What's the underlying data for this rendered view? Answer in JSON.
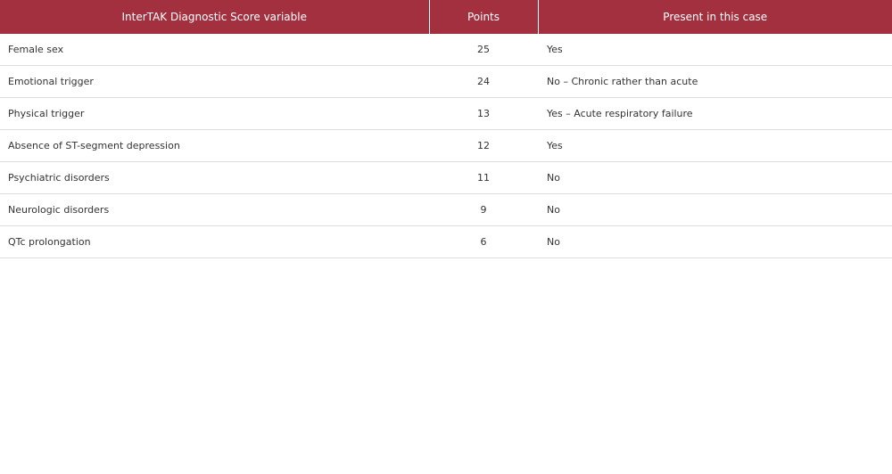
{
  "table": {
    "headers": {
      "variable": "InterTAK Diagnostic Score variable",
      "points": "Points",
      "present": "Present in this case"
    },
    "rows": [
      {
        "variable": "Female sex",
        "points": "25",
        "present": "Yes"
      },
      {
        "variable": "Emotional trigger",
        "points": "24",
        "present": "No – Chronic rather than acute"
      },
      {
        "variable": "Physical trigger",
        "points": "13",
        "present": "Yes – Acute respiratory failure"
      },
      {
        "variable": "Absence of ST-segment depression",
        "points": "12",
        "present": "Yes"
      },
      {
        "variable": "Psychiatric disorders",
        "points": "11",
        "present": "No"
      },
      {
        "variable": "Neurologic disorders",
        "points": "9",
        "present": "No"
      },
      {
        "variable": "QTc prolongation",
        "points": "6",
        "present": "No"
      }
    ],
    "header_color": "#a3303f"
  }
}
